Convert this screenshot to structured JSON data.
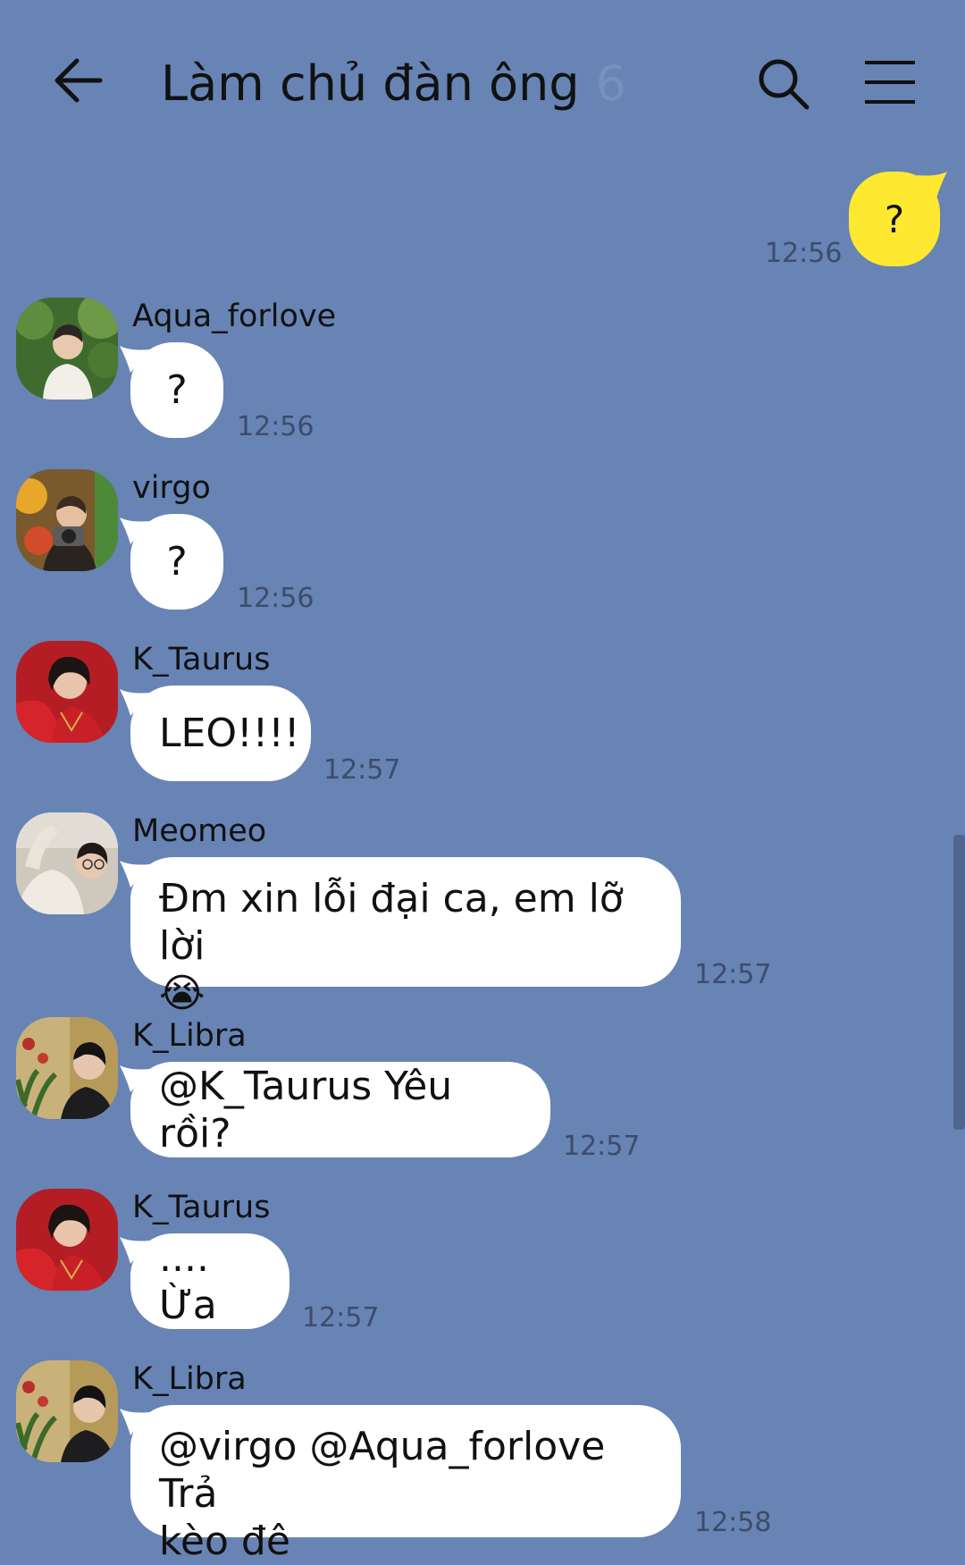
{
  "header": {
    "title": "Làm chủ đàn ông",
    "member_count": "6",
    "back_icon": "back-arrow-icon",
    "search_icon": "search-icon",
    "menu_icon": "hamburger-menu-icon"
  },
  "colors": {
    "background": "#6784b5",
    "my_bubble": "#ffe930",
    "their_bubble": "#ffffff"
  },
  "my_message": {
    "text": "?",
    "time": "12:56"
  },
  "messages": [
    {
      "sender": "Aqua_forlove",
      "text": "?",
      "time": "12:56"
    },
    {
      "sender": "virgo",
      "text": "?",
      "time": "12:56"
    },
    {
      "sender": "K_Taurus",
      "text": "LEO!!!!",
      "time": "12:57"
    },
    {
      "sender": "Meomeo",
      "text": "Đm xin lỗi đại ca, em lỡ lời",
      "emoji": "😭",
      "time": "12:57"
    },
    {
      "sender": "K_Libra",
      "text": "@K_Taurus Yêu rồi?",
      "time": "12:57"
    },
    {
      "sender": "K_Taurus",
      "text": ".... Ừa",
      "time": "12:57"
    },
    {
      "sender": "K_Libra",
      "text": "@virgo @Aqua_forlove Trả",
      "text_line2": "kèo đê",
      "time": "12:58"
    }
  ]
}
